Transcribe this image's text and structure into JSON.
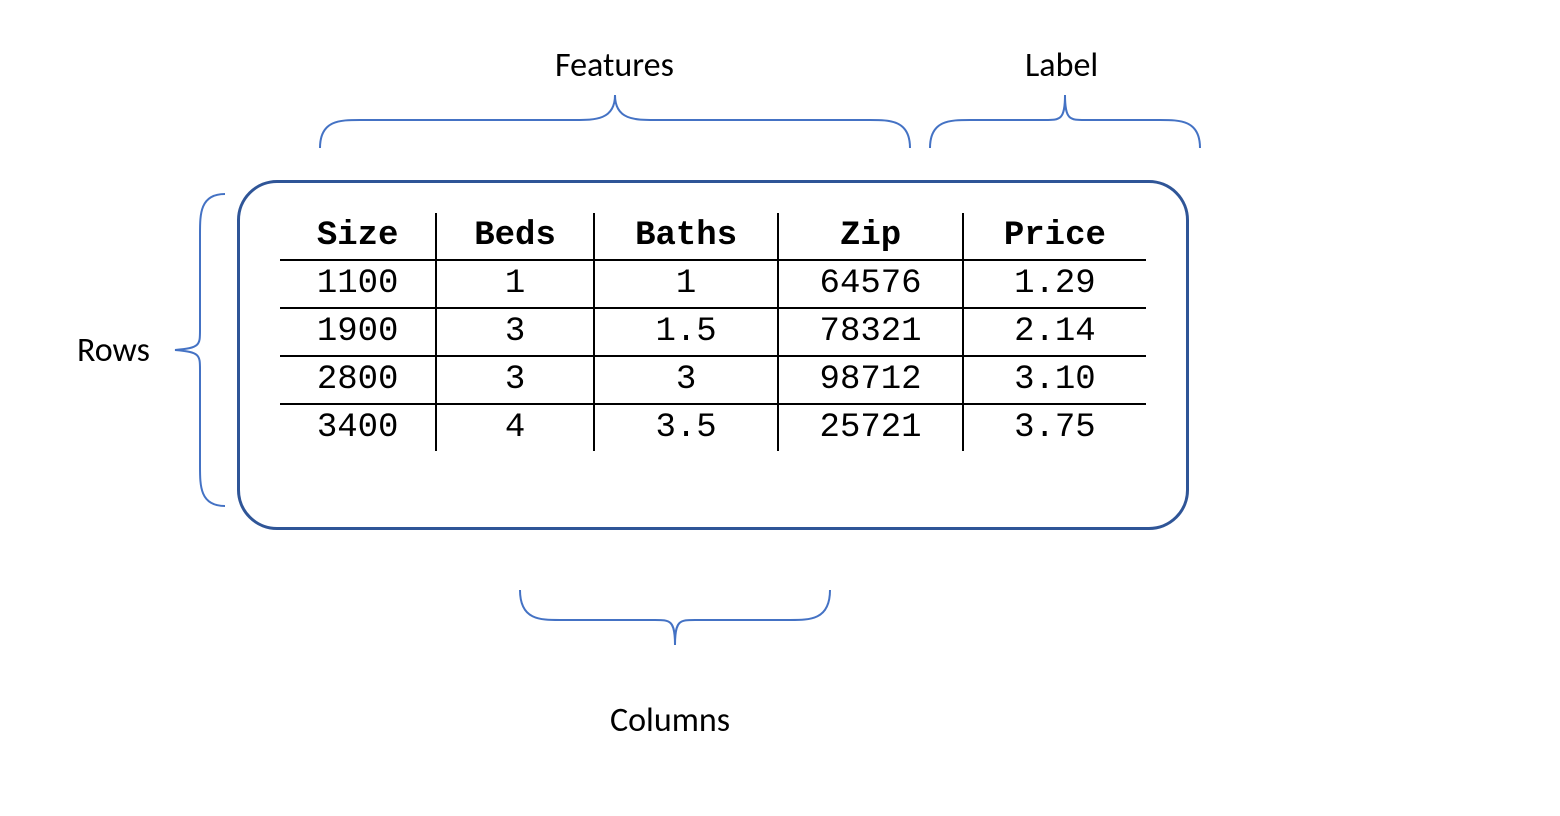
{
  "annotations": {
    "features": "Features",
    "label": "Label",
    "rows": "Rows",
    "columns": "Columns"
  },
  "chart_data": {
    "type": "table",
    "headers": [
      "Size",
      "Beds",
      "Baths",
      "Zip",
      "Price"
    ],
    "rows": [
      [
        "1100",
        "1",
        "1",
        "64576",
        "1.29"
      ],
      [
        "1900",
        "3",
        "1.5",
        "78321",
        "2.14"
      ],
      [
        "2800",
        "3",
        "3",
        "98712",
        "3.10"
      ],
      [
        "3400",
        "4",
        "3.5",
        "25721",
        "3.75"
      ]
    ],
    "groups": {
      "features_cols": [
        "Size",
        "Beds",
        "Baths",
        "Zip"
      ],
      "label_cols": [
        "Price"
      ]
    }
  }
}
